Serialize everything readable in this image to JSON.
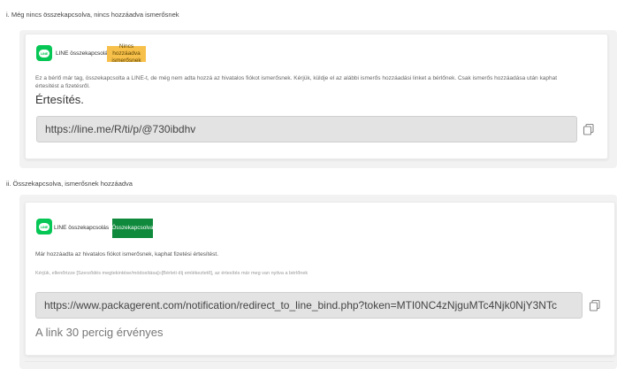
{
  "section1": {
    "heading": "i. Még nincs összekapcsolva, nincs hozzáadva ismerősnek",
    "line_label": "LINE összekapcsolás",
    "badge": "Nincs hozzáadva ismerősnek",
    "description_line1": "Ez a bérlő már tag, összekapcsolta a LINE-t, de még nem adta hozzá az hivatalos fiókot ismerősnek. Kérjük, küldje el az alábbi ismerős hozzáadási linket a bérlőnek. Csak ismerős hozzáadása után kaphat",
    "description_line2": "értesítést a fizetésről.",
    "notice_title": "Értesítés.",
    "url": "https://line.me/R/ti/p/@730ibdhv"
  },
  "section2": {
    "heading": "ii. Összekapcsolva, ismerősnek hozzáadva",
    "line_label": "LINE összekapcsolás",
    "badge": "Összekapcsolva",
    "description": "Már hozzáadta az hivatalos fiókot ismerősnek, kaphat fizetési értesítést.",
    "check_note": "Kérjük, ellenőrizze [Szerződés megtekintése/módosítása]»[Bérleti díj emlékeztető], az értesítés már meg van nyitva a bérlőnek",
    "url": "https://www.packagerent.com/notification/redirect_to_line_bind.php?token=MTI0NC4zNjguMTc4Njk0NjY3NTc",
    "expiry": "A link 30 percig érvényes"
  },
  "icons": {
    "line_logo": "line-app-icon",
    "copy": "copy-icon",
    "line_logo_text": "LINE"
  },
  "colors": {
    "line_green": "#06c755",
    "warning_badge": "#f7c04a",
    "success_badge": "#0f8a3c",
    "url_field_bg": "#e3e3e3"
  }
}
